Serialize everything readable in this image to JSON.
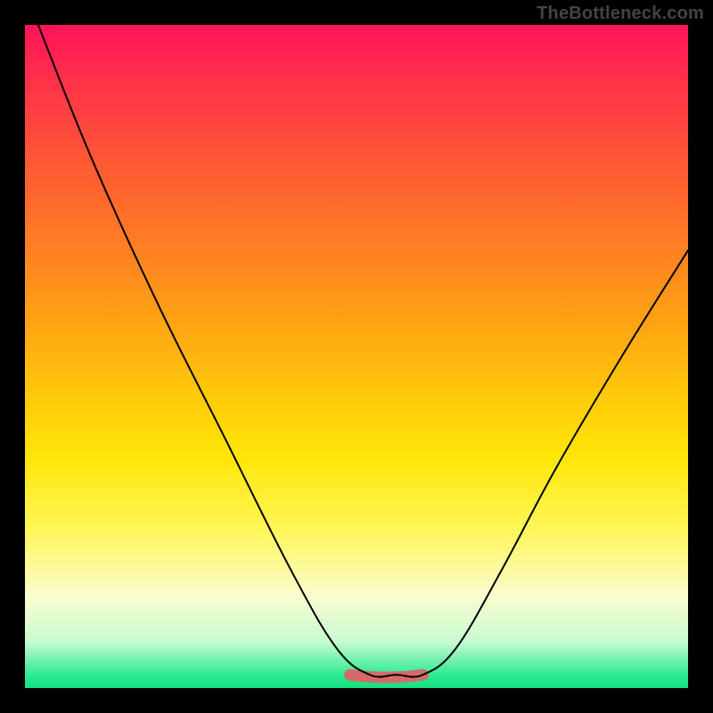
{
  "watermark": "TheBottleneck.com",
  "chart_data": {
    "type": "line",
    "title": "",
    "xlabel": "",
    "ylabel": "",
    "xlim": [
      0,
      100
    ],
    "ylim": [
      0,
      100
    ],
    "grid": false,
    "legend": false,
    "series": [
      {
        "name": "bottleneck-curve",
        "x": [
          2,
          10,
          20,
          30,
          40,
          47,
          52,
          56,
          60,
          65,
          72,
          80,
          90,
          100
        ],
        "y": [
          100,
          80,
          58,
          38,
          18,
          6,
          2,
          2,
          2,
          6,
          18,
          33,
          50,
          66
        ]
      }
    ],
    "highlight": {
      "name": "optimal-range",
      "x": [
        49,
        60
      ],
      "y": [
        2,
        2
      ],
      "color": "#d46a6a"
    },
    "gradient_colors": {
      "top": "#ff1459",
      "mid": "#ffe607",
      "bottom": "#13e07e"
    }
  }
}
